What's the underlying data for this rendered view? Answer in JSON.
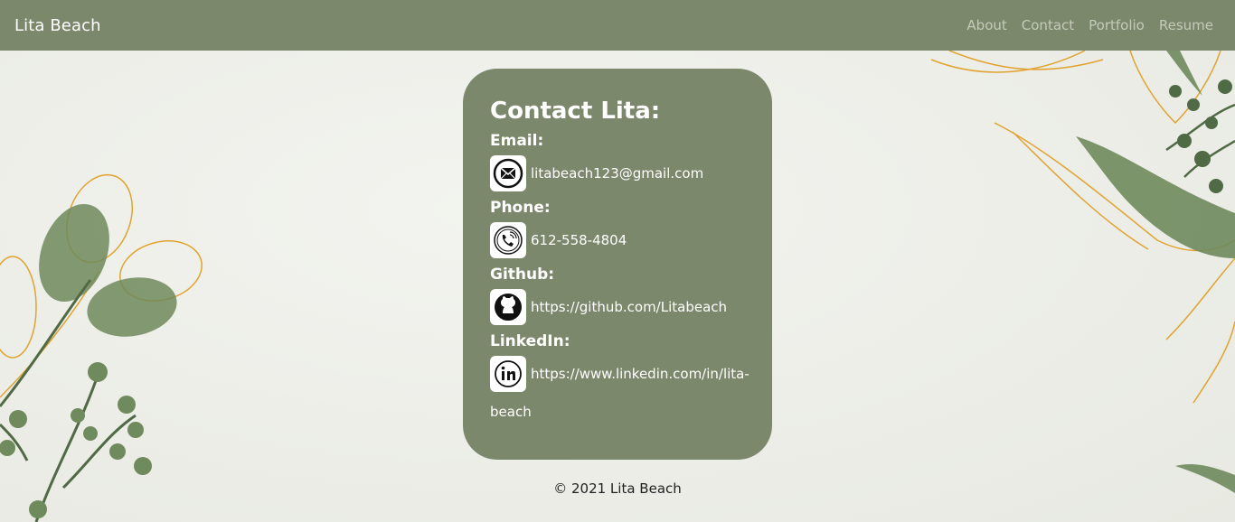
{
  "navbar": {
    "brand": "Lita Beach",
    "links": [
      "About",
      "Contact",
      "Portfolio",
      "Resume"
    ]
  },
  "contact": {
    "title": "Contact Lita:",
    "email_label": "Email:",
    "email_value": "litabeach123@gmail.com",
    "phone_label": "Phone:",
    "phone_value": "612-558-4804",
    "github_label": "Github:",
    "github_value": "https://github.com/Litabeach",
    "linkedin_label": "LinkedIn:",
    "linkedin_value_line1": "https://www.linkedin.com/in/lita-",
    "linkedin_value_line2": "beach"
  },
  "footer": {
    "text": "© 2021 Lita Beach"
  },
  "icons": {
    "email": "mail-icon",
    "phone": "phone-icon",
    "github": "github-icon",
    "linkedin": "linkedin-icon"
  },
  "colors": {
    "navbar": "#7b886b",
    "card": "#7b886b",
    "background": "#eef0ea",
    "leaf_green": "#6f8a5c",
    "gold_line": "#e0a330"
  }
}
